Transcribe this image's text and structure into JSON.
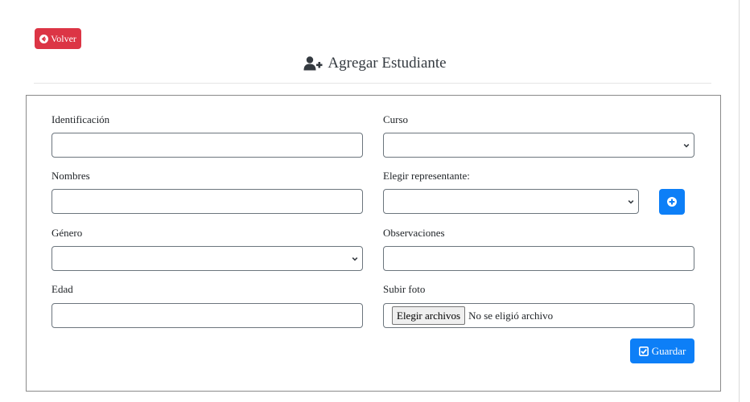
{
  "header": {
    "back_label": "Volver",
    "title": "Agregar Estudiante"
  },
  "form": {
    "identificacion": {
      "label": "Identificación",
      "value": ""
    },
    "curso": {
      "label": "Curso",
      "value": ""
    },
    "nombres": {
      "label": "Nombres",
      "value": ""
    },
    "representante": {
      "label": "Elegir representante:",
      "value": ""
    },
    "genero": {
      "label": "Género",
      "value": ""
    },
    "observaciones": {
      "label": "Observaciones",
      "value": ""
    },
    "edad": {
      "label": "Edad",
      "value": ""
    },
    "foto": {
      "label": "Subir foto",
      "button_label": "Elegir archivos",
      "status": "No se eligió archivo"
    },
    "save_label": "Guardar"
  },
  "icons": {
    "back": "arrow-circle-left-icon",
    "title": "user-plus-icon",
    "add_representative": "plus-circle-icon",
    "save": "check-square-icon",
    "select": "chevron-down-icon"
  },
  "colors": {
    "danger": "#dc3545",
    "primary": "#0d7ff7",
    "border": "#6c757d"
  }
}
